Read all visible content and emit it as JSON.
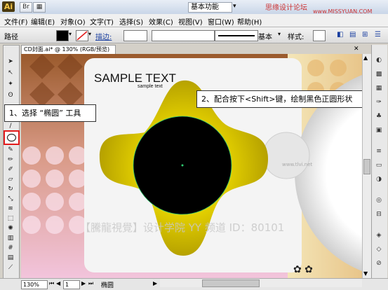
{
  "titlebar": {
    "app_logo": "Ai",
    "workspace": "基本功能",
    "watermark": "思缘设计论坛",
    "watermark_url": "www.MISSYUAN.COM"
  },
  "menu": [
    "文件(F)",
    "编辑(E)",
    "对象(O)",
    "文字(T)",
    "选择(S)",
    "效果(C)",
    "视图(V)",
    "窗口(W)",
    "帮助(H)"
  ],
  "control": {
    "path_label": "路径",
    "stroke_label": "描边:",
    "stroke_style": "基本",
    "style_label": "样式:"
  },
  "document": {
    "tab_title": "CD封面.ai* @ 130% (RGB/预览)"
  },
  "artwork": {
    "sample_title": "SAMPLE TEXT",
    "sample_sub": "sample text",
    "small_mark": "www.tlvi.net"
  },
  "callouts": {
    "step1": "1、选择 “椭圆” 工具",
    "step2": "2、配合按下<Shift>键，绘制黑色正圆形状"
  },
  "overlay_watermark": "【騰龍視覺】设计学院  YY 频道 ID：80101",
  "status": {
    "zoom": "130%",
    "page": "1",
    "tool": "椭圆"
  },
  "colors": {
    "fill": "#000000",
    "highlight": "#e21b1b",
    "yellow": "#d9c400"
  }
}
